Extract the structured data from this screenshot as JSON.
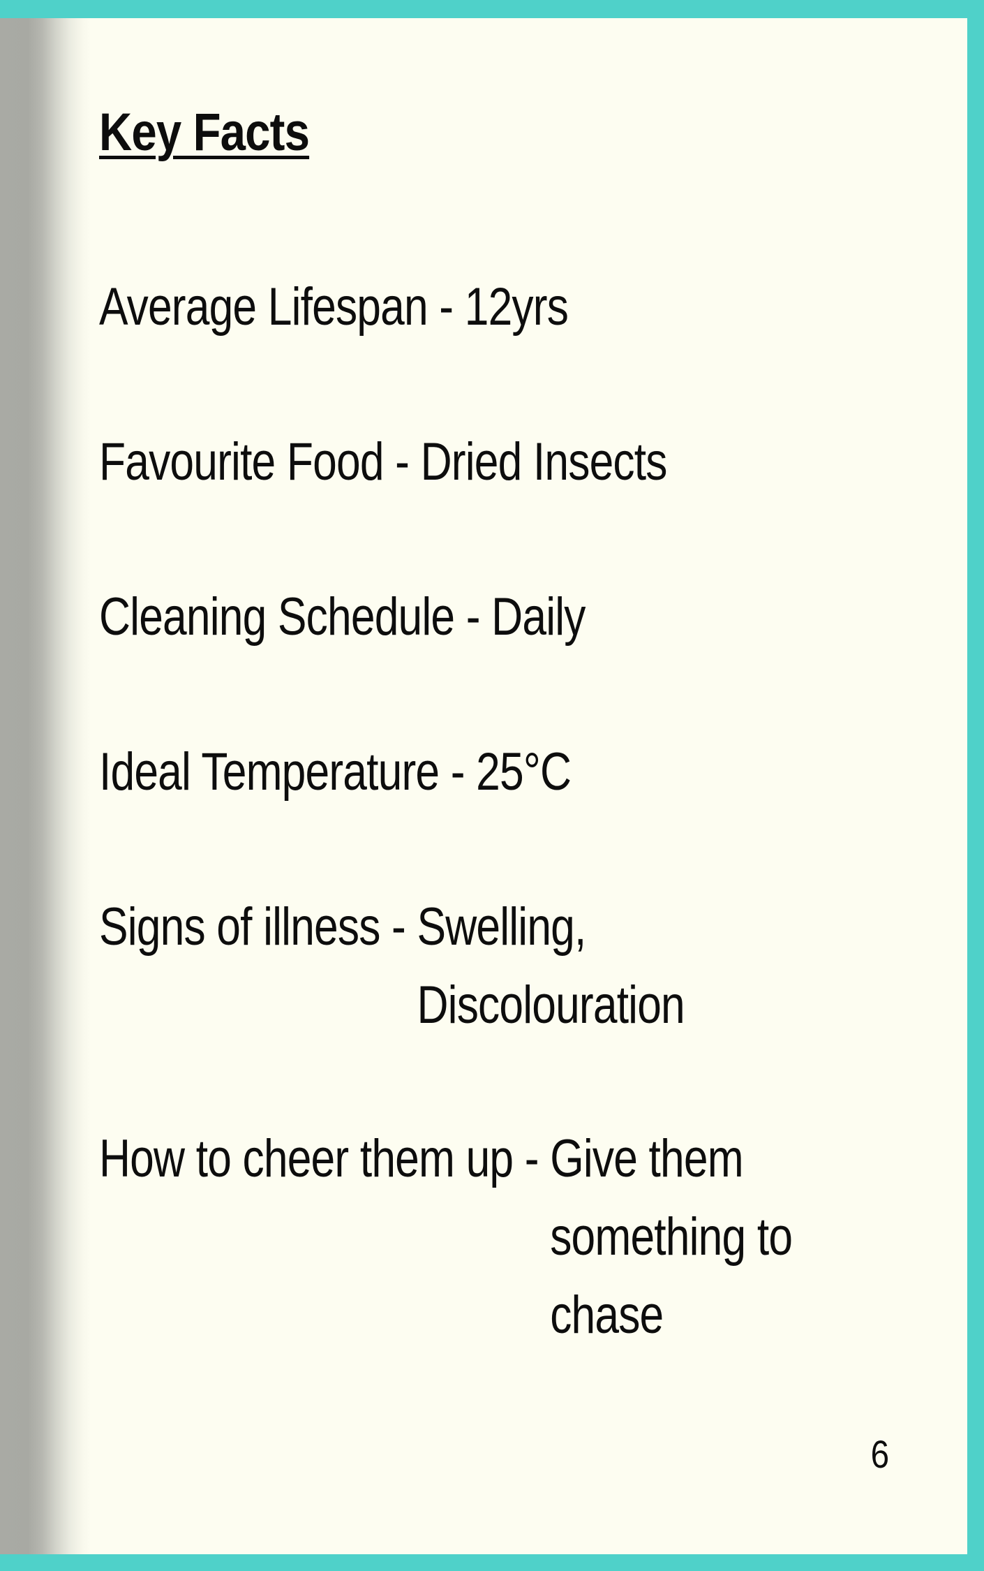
{
  "title": "Key Facts",
  "separator": " - ",
  "facts": [
    {
      "label": "Average Lifespan",
      "value_lines": [
        "12yrs"
      ]
    },
    {
      "label": "Favourite Food",
      "value_lines": [
        "Dried Insects"
      ]
    },
    {
      "label": "Cleaning Schedule",
      "value_lines": [
        "Daily"
      ]
    },
    {
      "label": "Ideal Temperature",
      "value_lines": [
        "25°C"
      ]
    },
    {
      "label": "Signs of illness",
      "value_lines": [
        "Swelling,",
        "Discolouration"
      ]
    },
    {
      "label": "How to cheer them up",
      "value_lines": [
        "Give them",
        "something to",
        "chase"
      ]
    }
  ],
  "page_number": "6",
  "colors": {
    "border": "#4fd1c9",
    "paper": "#fdfdf1",
    "text": "#0d0d0d"
  }
}
